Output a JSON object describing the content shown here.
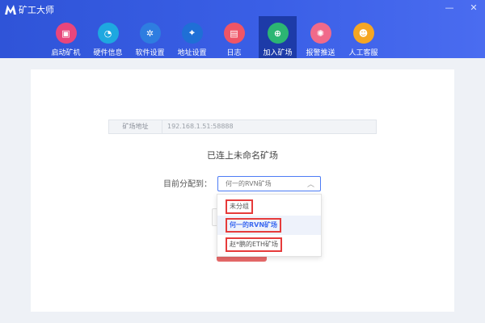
{
  "app": {
    "title": "矿工大师"
  },
  "window_controls": {
    "minimize": "—",
    "close": "✕"
  },
  "nav": [
    {
      "label": "启动矿机",
      "icon": "monitor-icon",
      "glyph": "▣",
      "color": "#e8467c"
    },
    {
      "label": "硬件信息",
      "icon": "gauge-icon",
      "glyph": "◔",
      "color": "#1ea8e0"
    },
    {
      "label": "软件设置",
      "icon": "gear-icon",
      "glyph": "✲",
      "color": "#2e7de0"
    },
    {
      "label": "地址设置",
      "icon": "location-icon",
      "glyph": "⌖",
      "color": "#1f6fd6"
    },
    {
      "label": "日志",
      "icon": "document-icon",
      "glyph": "▤",
      "color": "#ef5566"
    },
    {
      "label": "加入矿场",
      "icon": "join-icon",
      "glyph": "⊕",
      "color": "#2cb673",
      "active": true
    },
    {
      "label": "报警推送",
      "icon": "alarm-icon",
      "glyph": "✺",
      "color": "#f06a8a"
    },
    {
      "label": "人工客服",
      "icon": "headset-icon",
      "glyph": "☻",
      "color": "#f5a623"
    }
  ],
  "mine_address": {
    "label": "矿场地址",
    "value": "192.168.1.51:58888"
  },
  "status_text": "已连上未命名矿场",
  "assign": {
    "label": "目前分配到：",
    "selected": "何一的RVN矿场",
    "options": [
      "未分组",
      "何一的RVN矿场",
      "赵*鹏的ETH矿场"
    ]
  }
}
